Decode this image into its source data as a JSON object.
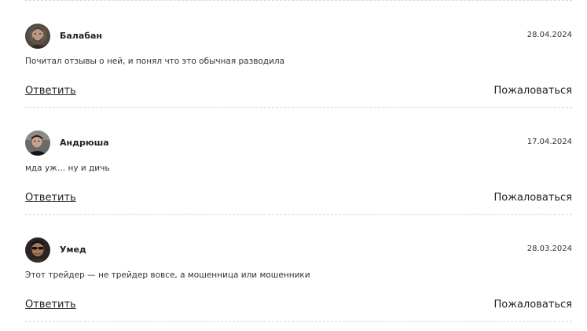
{
  "comments": [
    {
      "author": "Балабан",
      "date": "28.04.2024",
      "text": "Почитал отзывы о ней, и понял что это обычная разводила",
      "reply_label": "Ответить",
      "report_label": "Пожаловаться",
      "avatar_icon": "user-photo-avatar"
    },
    {
      "author": "Андрюша",
      "date": "17.04.2024",
      "text": "мда уж… ну и дичь",
      "reply_label": "Ответить",
      "report_label": "Пожаловаться",
      "avatar_icon": "user-photo-avatar"
    },
    {
      "author": "Умед",
      "date": "28.03.2024",
      "text": "Этот трейдер — не трейдер вовсе, а мошенница или мошенники",
      "reply_label": "Ответить",
      "report_label": "Пожаловаться",
      "avatar_icon": "user-photo-avatar"
    }
  ],
  "colors": {
    "text": "#222222",
    "divider": "#d9d9d9",
    "background": "#ffffff"
  }
}
